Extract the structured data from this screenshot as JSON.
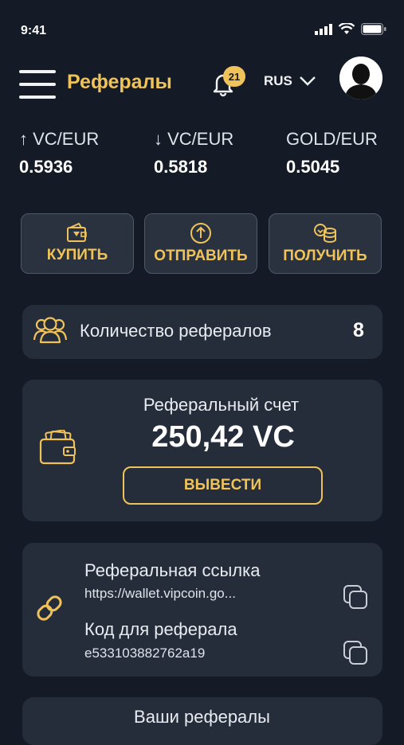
{
  "status_bar": {
    "time": "9:41"
  },
  "header": {
    "title": "Рефералы",
    "notification_count": "21",
    "language": "RUS"
  },
  "rates": [
    {
      "label": "↑ VC/EUR",
      "value": "0.5936"
    },
    {
      "label": "↓ VC/EUR",
      "value": "0.5818"
    },
    {
      "label": "GOLD/EUR",
      "value": "0.5045"
    }
  ],
  "actions": {
    "buy": "КУПИТЬ",
    "send": "ОТПРАВИТЬ",
    "receive": "ПОЛУЧИТЬ"
  },
  "referral_count": {
    "label": "Количество рефералов",
    "value": "8"
  },
  "referral_account": {
    "title": "Реферальный счет",
    "balance": "250,42 VC",
    "withdraw": "ВЫВЕСТИ"
  },
  "referral_link": {
    "title": "Реферальная ссылка",
    "url": "https://wallet.vipcoin.go...",
    "code_title": "Код для реферала",
    "code": "e533103882762a19"
  },
  "your_referrals": {
    "title": "Ваши рефералы"
  },
  "colors": {
    "accent": "#efc35a",
    "background": "#141b26",
    "card": "#262d3a"
  }
}
